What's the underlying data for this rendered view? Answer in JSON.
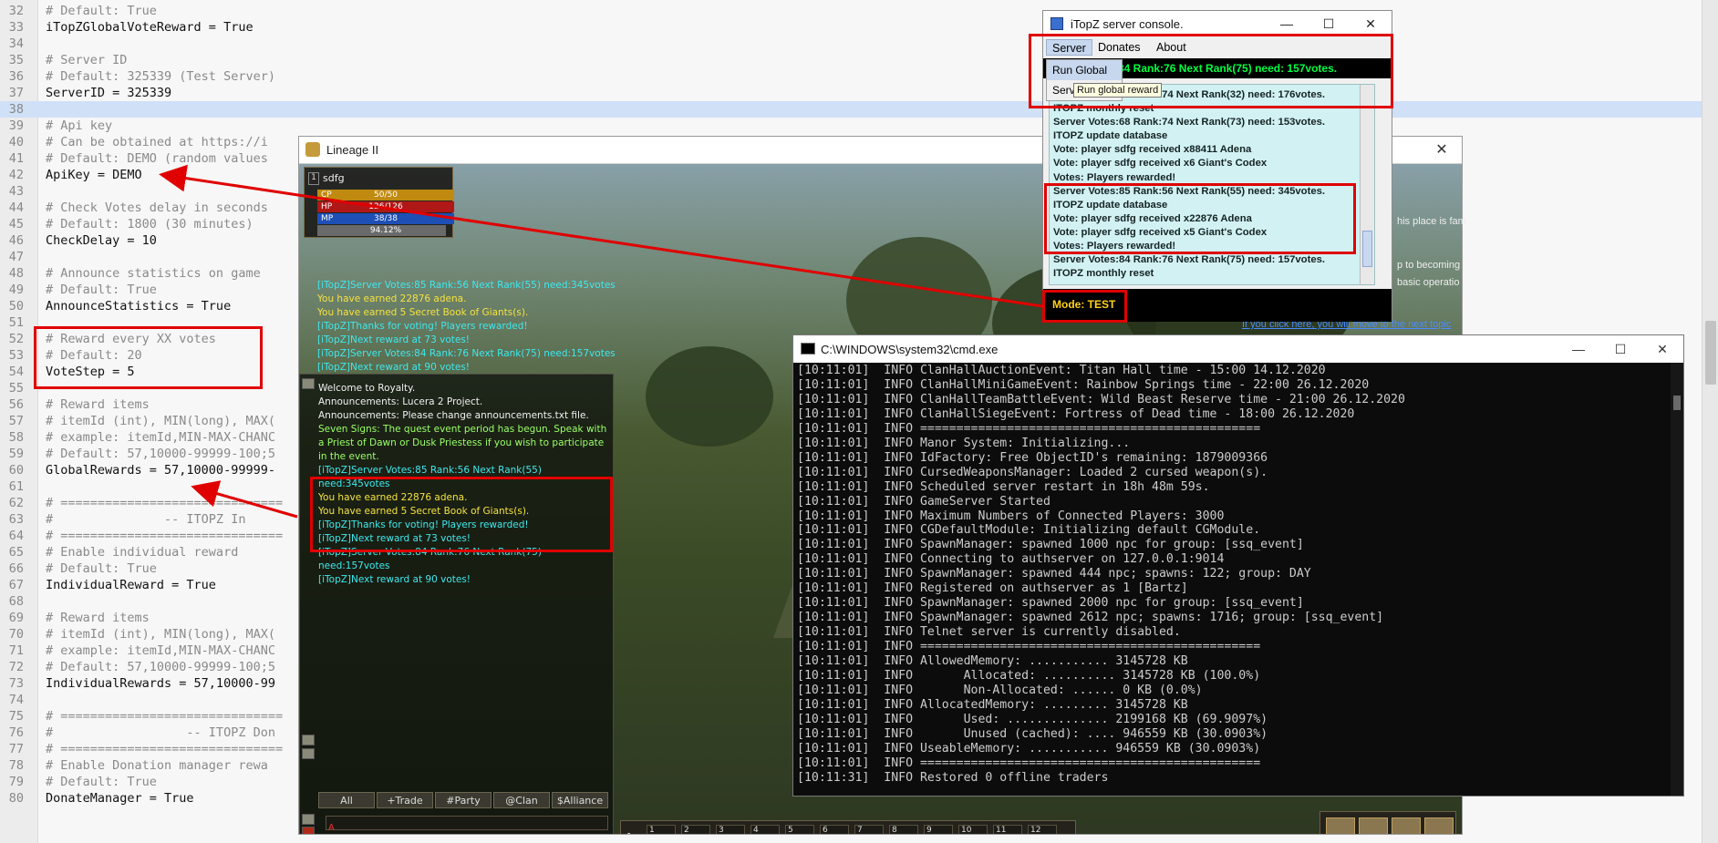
{
  "editor": {
    "lines": [
      {
        "n": "32",
        "text": "# Default: True",
        "kind": "comment"
      },
      {
        "n": "33",
        "text": "iTopZGlobalVoteReward = True",
        "kind": "setting"
      },
      {
        "n": "34",
        "text": "",
        "kind": "setting"
      },
      {
        "n": "35",
        "text": "# Server ID",
        "kind": "comment"
      },
      {
        "n": "36",
        "text": "# Default: 325339 (Test Server)",
        "kind": "comment"
      },
      {
        "n": "37",
        "text": "ServerID = 325339",
        "kind": "setting"
      },
      {
        "n": "38",
        "text": "",
        "kind": "highlight"
      },
      {
        "n": "39",
        "text": "# Api key",
        "kind": "comment"
      },
      {
        "n": "40",
        "text": "# Can be obtained at https://i",
        "kind": "comment"
      },
      {
        "n": "41",
        "text": "# Default: DEMO (random values",
        "kind": "comment"
      },
      {
        "n": "42",
        "text": "ApiKey = DEMO",
        "kind": "setting"
      },
      {
        "n": "43",
        "text": "",
        "kind": "setting"
      },
      {
        "n": "44",
        "text": "# Check Votes delay in seconds",
        "kind": "comment"
      },
      {
        "n": "45",
        "text": "# Default: 1800 (30 minutes)",
        "kind": "comment"
      },
      {
        "n": "46",
        "text": "CheckDelay = 10",
        "kind": "setting"
      },
      {
        "n": "47",
        "text": "",
        "kind": "setting"
      },
      {
        "n": "48",
        "text": "# Announce statistics on game",
        "kind": "comment"
      },
      {
        "n": "49",
        "text": "# Default: True",
        "kind": "comment"
      },
      {
        "n": "50",
        "text": "AnnounceStatistics = True",
        "kind": "setting"
      },
      {
        "n": "51",
        "text": "",
        "kind": "setting"
      },
      {
        "n": "52",
        "text": "# Reward every XX votes",
        "kind": "comment"
      },
      {
        "n": "53",
        "text": "# Default: 20",
        "kind": "comment"
      },
      {
        "n": "54",
        "text": "VoteStep = 5",
        "kind": "setting"
      },
      {
        "n": "55",
        "text": "",
        "kind": "setting"
      },
      {
        "n": "56",
        "text": "# Reward items",
        "kind": "comment"
      },
      {
        "n": "57",
        "text": "# itemId (int), MIN(long), MAX(",
        "kind": "comment"
      },
      {
        "n": "58",
        "text": "# example: itemId,MIN-MAX-CHANC",
        "kind": "comment"
      },
      {
        "n": "59",
        "text": "# Default: 57,10000-99999-100;5",
        "kind": "comment"
      },
      {
        "n": "60",
        "text": "GlobalRewards = 57,10000-99999-",
        "kind": "setting"
      },
      {
        "n": "61",
        "text": "",
        "kind": "setting"
      },
      {
        "n": "62",
        "text": "# ==============================",
        "kind": "comment"
      },
      {
        "n": "63",
        "text": "#               -- ITOPZ In",
        "kind": "comment"
      },
      {
        "n": "64",
        "text": "# ==============================",
        "kind": "comment"
      },
      {
        "n": "65",
        "text": "# Enable individual reward",
        "kind": "comment"
      },
      {
        "n": "66",
        "text": "# Default: True",
        "kind": "comment"
      },
      {
        "n": "67",
        "text": "IndividualReward = True",
        "kind": "setting"
      },
      {
        "n": "68",
        "text": "",
        "kind": "setting"
      },
      {
        "n": "69",
        "text": "# Reward items",
        "kind": "comment"
      },
      {
        "n": "70",
        "text": "# itemId (int), MIN(long), MAX(",
        "kind": "comment"
      },
      {
        "n": "71",
        "text": "# example: itemId,MIN-MAX-CHANC",
        "kind": "comment"
      },
      {
        "n": "72",
        "text": "# Default: 57,10000-99999-100;5",
        "kind": "comment"
      },
      {
        "n": "73",
        "text": "IndividualRewards = 57,10000-99",
        "kind": "setting"
      },
      {
        "n": "74",
        "text": "",
        "kind": "setting"
      },
      {
        "n": "75",
        "text": "# ==============================",
        "kind": "comment"
      },
      {
        "n": "76",
        "text": "#                  -- ITOPZ Don",
        "kind": "comment"
      },
      {
        "n": "77",
        "text": "# ==============================",
        "kind": "comment"
      },
      {
        "n": "78",
        "text": "# Enable Donation manager rewa",
        "kind": "comment"
      },
      {
        "n": "79",
        "text": "# Default: True",
        "kind": "comment"
      },
      {
        "n": "80",
        "text": "DonateManager = True",
        "kind": "setting"
      }
    ]
  },
  "lineage": {
    "title": "Lineage II",
    "character": {
      "level": "1",
      "name": "sdfg",
      "cp": "50/50",
      "hp": "126/126",
      "mp": "38/38",
      "exp": "94.12%"
    },
    "overlay_messages": [
      {
        "text": "[iTopZ]Server Votes:85 Rank:56 Next Rank(55) need:345votes",
        "color": "cyan"
      },
      {
        "text": "You have earned 22876 adena.",
        "color": "yellow"
      },
      {
        "text": "You have earned 5 Secret Book of Giants(s).",
        "color": "yellow"
      },
      {
        "text": "[iTopZ]Thanks for voting! Players rewarded!",
        "color": "cyan"
      },
      {
        "text": "[iTopZ]Next reward at 73 votes!",
        "color": "cyan"
      },
      {
        "text": "[iTopZ]Server Votes:84 Rank:76 Next Rank(75) need:157votes",
        "color": "cyan"
      },
      {
        "text": "[iTopZ]Next reward at 90 votes!",
        "color": "cyan"
      }
    ],
    "chat_messages": [
      {
        "text": "Welcome to Royalty.",
        "color": "white"
      },
      {
        "text": "Announcements: Lucera 2 Project.",
        "color": "white"
      },
      {
        "text": "Announcements: Please change announcements.txt file.",
        "color": "white"
      },
      {
        "text": "Seven Signs: The quest event period has begun. Speak with a Priest of Dawn or Dusk Priestess if you wish to participate in the event.",
        "color": "green"
      },
      {
        "text": "[iTopZ]Server Votes:85 Rank:56 Next Rank(55) need:345votes",
        "color": "cyan"
      },
      {
        "text": "You have earned 22876 adena.",
        "color": "yellow"
      },
      {
        "text": "You have earned 5 Secret Book of Giants(s).",
        "color": "yellow"
      },
      {
        "text": "[iTopZ]Thanks for voting! Players rewarded!",
        "color": "cyan"
      },
      {
        "text": "[iTopZ]Next reward at 73 votes!",
        "color": "cyan"
      },
      {
        "text": "[iTopZ]Server Votes:84 Rank:76 Next Rank(75) need:157votes",
        "color": "cyan"
      },
      {
        "text": "[iTopZ]Next reward at 90 votes!",
        "color": "cyan"
      }
    ],
    "chat_tabs": [
      "All",
      "+Trade",
      "#Party",
      "@Clan",
      "$Alliance"
    ],
    "chat_input_glyph": "A",
    "hotbar_page": "1",
    "hotbar_slots": [
      "1",
      "2",
      "3",
      "4",
      "5",
      "6",
      "7",
      "8",
      "9",
      "10",
      "11",
      "12"
    ],
    "forum_snippets": {
      "line1": "his place is fam",
      "line2": "p to becoming",
      "line3": "basic operatio",
      "link": "If you click here, you will move to the next topic"
    }
  },
  "itopz": {
    "title": "iTopZ server console.",
    "menu": [
      "Server",
      "Donates",
      "About"
    ],
    "status": "84 Rank:76 Next Rank(75) need: 157votes.",
    "dropdown": [
      "Run Global",
      "Server Info"
    ],
    "tooltip": "Run global reward",
    "log": [
      "Server Votes:84 Rank:74 Next Rank(32) need: 176votes.",
      "ITOPZ monthly reset",
      "Server Votes:68 Rank:74 Next Rank(73) need: 153votes.",
      "ITOPZ update database",
      "Vote: player sdfg received x88411 Adena",
      "Vote: player sdfg received x6 Giant's Codex",
      "Votes: Players rewarded!",
      "Server Votes:85 Rank:56 Next Rank(55) need: 345votes.",
      "ITOPZ update database",
      "Vote: player sdfg received x22876 Adena",
      "Vote: player sdfg received x5 Giant's Codex",
      "Votes: Players rewarded!",
      "Server Votes:84 Rank:76 Next Rank(75) need: 157votes.",
      "ITOPZ monthly reset"
    ],
    "mode": "Mode: TEST"
  },
  "cmd": {
    "title": "C:\\WINDOWS\\system32\\cmd.exe",
    "lines": [
      "[10:11:01]  INFO ClanHallAuctionEvent: Titan Hall time - 15:00 14.12.2020",
      "[10:11:01]  INFO ClanHallMiniGameEvent: Rainbow Springs time - 22:00 26.12.2020",
      "[10:11:01]  INFO ClanHallTeamBattleEvent: Wild Beast Reserve time - 21:00 26.12.2020",
      "[10:11:01]  INFO ClanHallSiegeEvent: Fortress of Dead time - 18:00 26.12.2020",
      "[10:11:01]  INFO ===============================================",
      "[10:11:01]  INFO Manor System: Initializing...",
      "[10:11:01]  INFO IdFactory: Free ObjectID's remaining: 1879009366",
      "[10:11:01]  INFO CursedWeaponsManager: Loaded 2 cursed weapon(s).",
      "[10:11:01]  INFO Scheduled server restart in 18h 48m 59s.",
      "[10:11:01]  INFO GameServer Started",
      "[10:11:01]  INFO Maximum Numbers of Connected Players: 3000",
      "[10:11:01]  INFO CGDefaultModule: Initializing default CGModule.",
      "[10:11:01]  INFO SpawnManager: spawned 1000 npc for group: [ssq_event]",
      "[10:11:01]  INFO Connecting to authserver on 127.0.0.1:9014",
      "[10:11:01]  INFO SpawnManager: spawned 444 npc; spawns: 122; group: DAY",
      "[10:11:01]  INFO Registered on authserver as 1 [Bartz]",
      "[10:11:01]  INFO SpawnManager: spawned 2000 npc for group: [ssq_event]",
      "[10:11:01]  INFO SpawnManager: spawned 2612 npc; spawns: 1716; group: [ssq_event]",
      "[10:11:01]  INFO Telnet server is currently disabled.",
      "[10:11:01]  INFO ===============================================",
      "[10:11:01]  INFO AllowedMemory: ........... 3145728 KB",
      "[10:11:01]  INFO       Allocated: .......... 3145728 KB (100.0%)",
      "[10:11:01]  INFO       Non-Allocated: ...... 0 KB (0.0%)",
      "[10:11:01]  INFO AllocatedMemory: ......... 3145728 KB",
      "[10:11:01]  INFO       Used: .............. 2199168 KB (69.9097%)",
      "[10:11:01]  INFO       Unused (cached): .... 946559 KB (30.0903%)",
      "[10:11:01]  INFO UseableMemory: ........... 946559 KB (30.0903%)",
      "[10:11:01]  INFO ===============================================",
      "[10:11:31]  INFO Restored 0 offline traders"
    ]
  },
  "colors": {
    "annotation": "#e00000",
    "console_status": "#00ff40",
    "mode_text": "#ffd21a",
    "log_bg": "#d2f1f3"
  }
}
